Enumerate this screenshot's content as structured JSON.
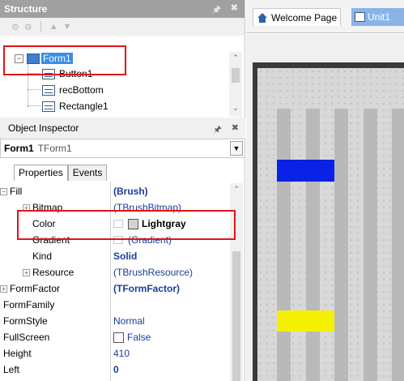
{
  "structure": {
    "title": "Structure",
    "tree": [
      {
        "label": "Form1",
        "selected": true
      },
      {
        "label": "Button1"
      },
      {
        "label": "recBottom"
      },
      {
        "label": "Rectangle1"
      }
    ]
  },
  "object_inspector": {
    "title": "Object Inspector",
    "selected_object_name": "Form1",
    "selected_object_type": "TForm1",
    "tabs": [
      "Properties",
      "Events"
    ],
    "properties": [
      {
        "name": "Fill",
        "value": "(Brush)"
      },
      {
        "name": "Bitmap",
        "value": "(TBrushBitmap)"
      },
      {
        "name": "Color",
        "value": "Lightgray"
      },
      {
        "name": "Gradient",
        "value": "(Gradient)"
      },
      {
        "name": "Kind",
        "value": "Solid"
      },
      {
        "name": "Resource",
        "value": "(TBrushResource)"
      },
      {
        "name": "FormFactor",
        "value": "(TFormFactor)"
      },
      {
        "name": "FormFamily",
        "value": ""
      },
      {
        "name": "FormStyle",
        "value": "Normal"
      },
      {
        "name": "FullScreen",
        "value": "False"
      },
      {
        "name": "Height",
        "value": "410"
      },
      {
        "name": "Left",
        "value": "0"
      }
    ]
  },
  "editor_tabs": [
    {
      "label": "Welcome Page",
      "icon": "home-icon"
    },
    {
      "label": "Unit1",
      "icon": "unit-icon"
    }
  ],
  "colors": {
    "accent_highlight": "#e0151a",
    "selection": "#3a8ee6",
    "rect_blue": "#0a22e6",
    "rect_yellow": "#f5f000",
    "form_fill": "#d3d3d3"
  }
}
